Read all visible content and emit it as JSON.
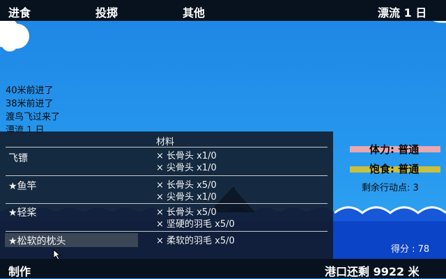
{
  "menu": {
    "eat": "进食",
    "throw": "投掷",
    "other": "其他",
    "day": "漂流 1 日"
  },
  "log": [
    "40米前进了",
    "38米前进了",
    "渡鸟飞过来了",
    "漂流 1 日"
  ],
  "craft": {
    "header": "材料",
    "recipes": [
      {
        "name": "飞镖",
        "materials": [
          "× 长骨头 x1/0",
          "× 尖骨头 x1/0"
        ]
      },
      {
        "name": "★鱼竿",
        "materials": [
          "× 长骨头 x5/0",
          "× 尖骨头 x1/0"
        ]
      },
      {
        "name": "★轻桨",
        "materials": [
          "× 长骨头 x5/0",
          "× 坚硬的羽毛 x5/0"
        ]
      },
      {
        "name": "★松软的枕头",
        "materials": [
          "× 柔软的羽毛 x5/0"
        ]
      }
    ]
  },
  "stats": {
    "stamina": "体力: 普通",
    "hunger": "饱食: 普通",
    "moves": "剩余行动点: 3",
    "score": "得分 : 78"
  },
  "bottom": {
    "craft": "制作",
    "port": "港口还剩 9922 米"
  },
  "colors": {
    "bar_dark": "#08121e",
    "stamina_bar": "#e8a8b0",
    "hunger_bar": "#c8c040"
  }
}
